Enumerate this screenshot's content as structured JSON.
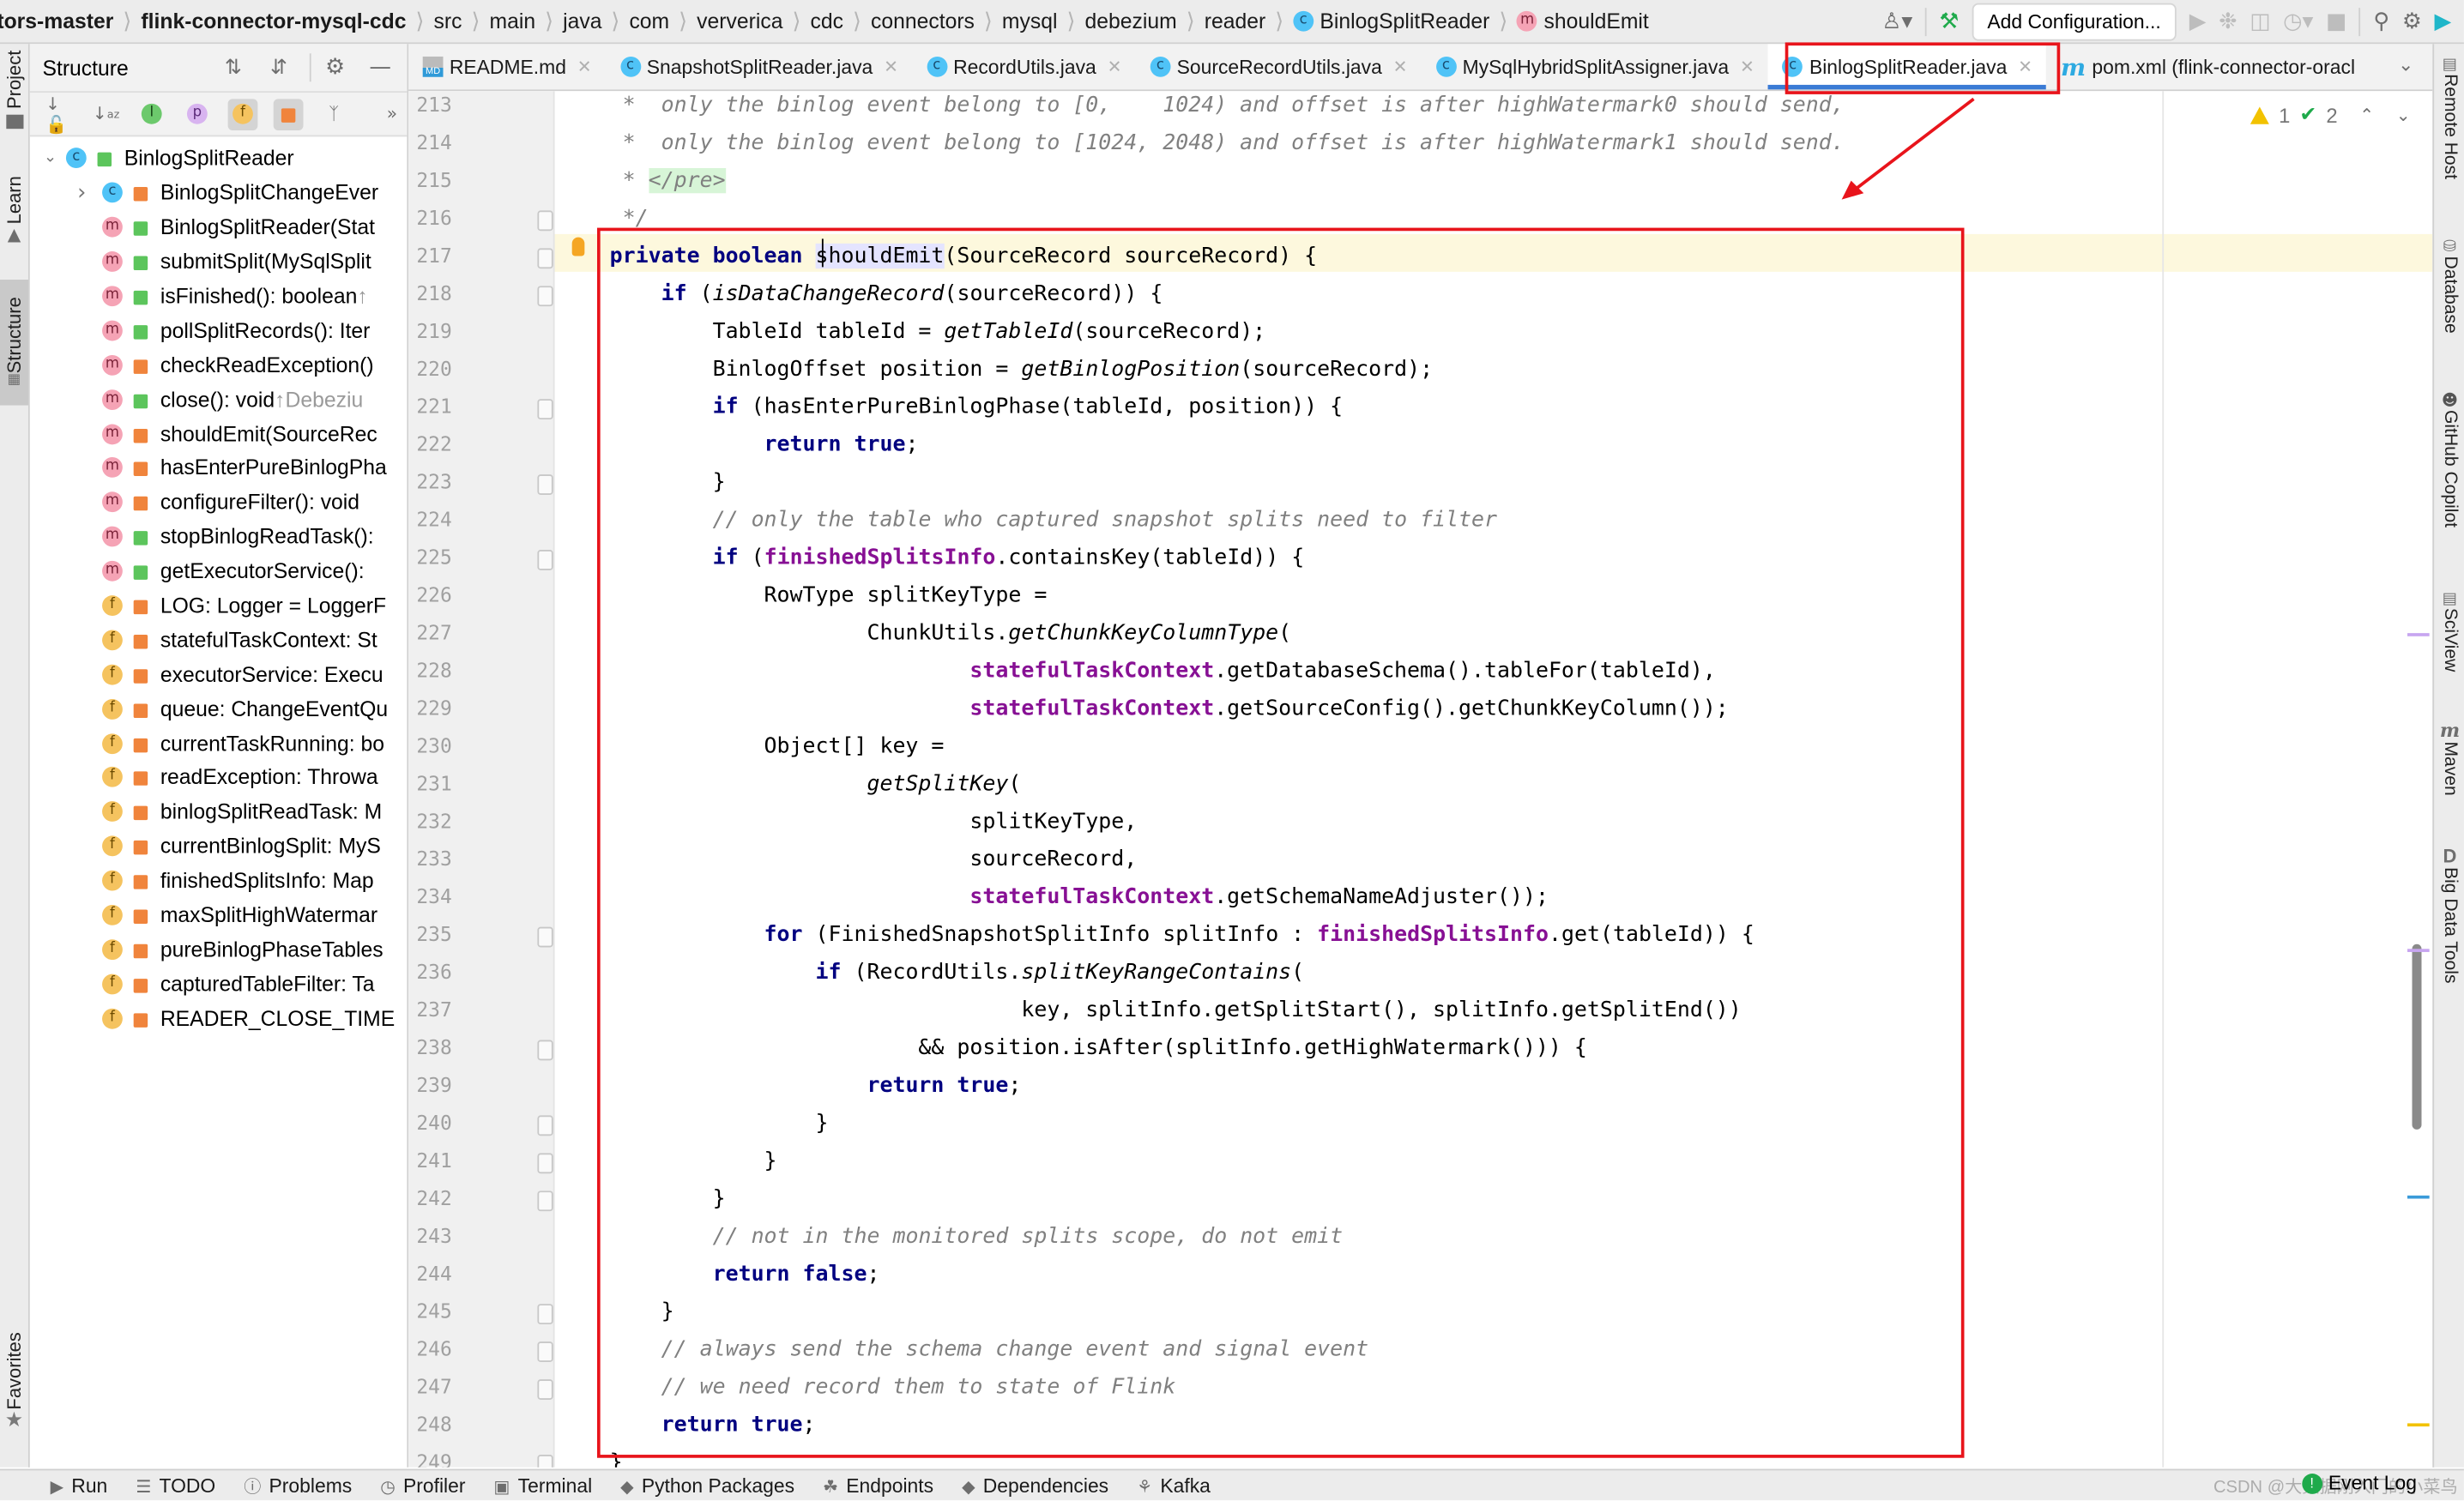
{
  "breadcrumb": {
    "items": [
      {
        "label": "tors-master",
        "bold": true
      },
      {
        "label": "flink-connector-mysql-cdc",
        "bold": true
      },
      {
        "label": "src"
      },
      {
        "label": "main"
      },
      {
        "label": "java"
      },
      {
        "label": "com"
      },
      {
        "label": "ververica"
      },
      {
        "label": "cdc"
      },
      {
        "label": "connectors"
      },
      {
        "label": "mysql"
      },
      {
        "label": "debezium"
      },
      {
        "label": "reader"
      },
      {
        "label": "BinlogSplitReader",
        "icon": "c"
      },
      {
        "label": "shouldEmit",
        "icon": "m"
      }
    ]
  },
  "toolbar": {
    "add_configuration": "Add Configuration..."
  },
  "left_strip": {
    "tabs": [
      "Project",
      "Learn",
      "Structure",
      "Favorites"
    ]
  },
  "right_strip": {
    "tabs": [
      "Remote Host",
      "Database",
      "GitHub Copilot",
      "SciView",
      "Maven",
      "Big Data Tools"
    ]
  },
  "structure": {
    "title": "Structure",
    "root": "BinlogSplitReader",
    "items": [
      {
        "kind": "c",
        "vis": "private",
        "label": "BinlogSplitChangeEver",
        "expandable": true
      },
      {
        "kind": "m",
        "vis": "public",
        "label": "BinlogSplitReader(Stat"
      },
      {
        "kind": "m",
        "vis": "public",
        "label": "submitSplit(MySqlSplit"
      },
      {
        "kind": "m",
        "vis": "public",
        "label": "isFinished(): boolean",
        "hint": " ↑"
      },
      {
        "kind": "m",
        "vis": "public",
        "label": "pollSplitRecords(): Iter"
      },
      {
        "kind": "m",
        "vis": "private",
        "label": "checkReadException()"
      },
      {
        "kind": "m",
        "vis": "public",
        "label": "close(): void",
        "hint": " ↑Debeziu"
      },
      {
        "kind": "m",
        "vis": "private",
        "label": "shouldEmit(SourceRec"
      },
      {
        "kind": "m",
        "vis": "private",
        "label": "hasEnterPureBinlogPha"
      },
      {
        "kind": "m",
        "vis": "private",
        "label": "configureFilter(): void"
      },
      {
        "kind": "m",
        "vis": "public",
        "label": "stopBinlogReadTask():"
      },
      {
        "kind": "m",
        "vis": "public",
        "label": "getExecutorService(): "
      },
      {
        "kind": "f",
        "vis": "private",
        "label": "LOG: Logger = LoggerF"
      },
      {
        "kind": "f",
        "vis": "private",
        "label": "statefulTaskContext: St"
      },
      {
        "kind": "f",
        "vis": "private",
        "label": "executorService: Execu"
      },
      {
        "kind": "f",
        "vis": "private",
        "label": "queue: ChangeEventQu"
      },
      {
        "kind": "f",
        "vis": "private",
        "label": "currentTaskRunning: bo"
      },
      {
        "kind": "f",
        "vis": "private",
        "label": "readException: Throwa"
      },
      {
        "kind": "f",
        "vis": "private",
        "label": "binlogSplitReadTask: M"
      },
      {
        "kind": "f",
        "vis": "private",
        "label": "currentBinlogSplit: MyS"
      },
      {
        "kind": "f",
        "vis": "private",
        "label": "finishedSplitsInfo: Map"
      },
      {
        "kind": "f",
        "vis": "private",
        "label": "maxSplitHighWatermar"
      },
      {
        "kind": "f",
        "vis": "private",
        "label": "pureBinlogPhaseTables"
      },
      {
        "kind": "f",
        "vis": "private",
        "label": "capturedTableFilter: Ta"
      },
      {
        "kind": "f",
        "vis": "private",
        "label": "READER_CLOSE_TIME"
      }
    ]
  },
  "tabs": [
    {
      "label": "README.md",
      "icon": "md"
    },
    {
      "label": "SnapshotSplitReader.java",
      "icon": "c"
    },
    {
      "label": "RecordUtils.java",
      "icon": "c"
    },
    {
      "label": "SourceRecordUtils.java",
      "icon": "c"
    },
    {
      "label": "MySqlHybridSplitAssigner.java",
      "icon": "c"
    },
    {
      "label": "BinlogSplitReader.java",
      "icon": "c",
      "active": true
    },
    {
      "label": "pom.xml (flink-connector-oracl",
      "icon": "maven"
    }
  ],
  "inspections": {
    "warnings": "1",
    "weak_warnings": "2"
  },
  "editor": {
    "first_line": 213,
    "current_line": 217,
    "lines": [
      [
        [
          "cm",
          " *  only the binlog event belong to [0,    1024) and offset is after highWatermark0 should send,"
        ]
      ],
      [
        [
          "cm",
          " *  only the binlog event belong to [1024, 2048) and offset is after highWatermark1 should send."
        ]
      ],
      [
        [
          "cm",
          " * "
        ],
        [
          "tag",
          "</pre>"
        ]
      ],
      [
        [
          "cm",
          " */"
        ]
      ],
      [
        [
          "kw",
          "private boolean "
        ],
        [
          "sel",
          "shouldEmit"
        ],
        [
          "",
          "(SourceRecord sourceRecord) {"
        ]
      ],
      [
        [
          "",
          "    "
        ],
        [
          "kw",
          "if"
        ],
        [
          "",
          " ("
        ],
        [
          "it",
          "isDataChangeRecord"
        ],
        [
          "",
          "(sourceRecord)) {"
        ]
      ],
      [
        [
          "",
          "        TableId tableId = "
        ],
        [
          "it",
          "getTableId"
        ],
        [
          "",
          "(sourceRecord);"
        ]
      ],
      [
        [
          "",
          "        BinlogOffset position = "
        ],
        [
          "it",
          "getBinlogPosition"
        ],
        [
          "",
          "(sourceRecord);"
        ]
      ],
      [
        [
          "",
          "        "
        ],
        [
          "kw",
          "if"
        ],
        [
          "",
          " (hasEnterPureBinlogPhase(tableId, position)) {"
        ]
      ],
      [
        [
          "",
          "            "
        ],
        [
          "kw",
          "return true"
        ],
        [
          "",
          ";"
        ]
      ],
      [
        [
          "",
          "        }"
        ]
      ],
      [
        [
          "",
          "        "
        ],
        [
          "cm",
          "// only the table who captured snapshot splits need to filter"
        ]
      ],
      [
        [
          "",
          "        "
        ],
        [
          "kw",
          "if"
        ],
        [
          "",
          " ("
        ],
        [
          "fld",
          "finishedSplitsInfo"
        ],
        [
          "",
          ".containsKey(tableId)) {"
        ]
      ],
      [
        [
          "",
          "            RowType splitKeyType ="
        ]
      ],
      [
        [
          "",
          "                    ChunkUtils."
        ],
        [
          "it",
          "getChunkKeyColumnType"
        ],
        [
          "",
          "("
        ]
      ],
      [
        [
          "",
          "                            "
        ],
        [
          "fld",
          "statefulTaskContext"
        ],
        [
          "",
          ".getDatabaseSchema().tableFor(tableId),"
        ]
      ],
      [
        [
          "",
          "                            "
        ],
        [
          "fld",
          "statefulTaskContext"
        ],
        [
          "",
          ".getSourceConfig().getChunkKeyColumn());"
        ]
      ],
      [
        [
          "",
          "            Object[] key ="
        ]
      ],
      [
        [
          "",
          "                    "
        ],
        [
          "it",
          "getSplitKey"
        ],
        [
          "",
          "("
        ]
      ],
      [
        [
          "",
          "                            splitKeyType,"
        ]
      ],
      [
        [
          "",
          "                            sourceRecord,"
        ]
      ],
      [
        [
          "",
          "                            "
        ],
        [
          "fld",
          "statefulTaskContext"
        ],
        [
          "",
          ".getSchemaNameAdjuster());"
        ]
      ],
      [
        [
          "",
          "            "
        ],
        [
          "kw",
          "for"
        ],
        [
          "",
          " (FinishedSnapshotSplitInfo splitInfo : "
        ],
        [
          "fld",
          "finishedSplitsInfo"
        ],
        [
          "",
          ".get(tableId)) {"
        ]
      ],
      [
        [
          "",
          "                "
        ],
        [
          "kw",
          "if"
        ],
        [
          "",
          " (RecordUtils."
        ],
        [
          "it",
          "splitKeyRangeContains"
        ],
        [
          "",
          "("
        ]
      ],
      [
        [
          "",
          "                                key, splitInfo.getSplitStart(), splitInfo.getSplitEnd())"
        ]
      ],
      [
        [
          "",
          "                        && position.isAfter(splitInfo.getHighWatermark())) {"
        ]
      ],
      [
        [
          "",
          "                    "
        ],
        [
          "kw",
          "return true"
        ],
        [
          "",
          ";"
        ]
      ],
      [
        [
          "",
          "                }"
        ]
      ],
      [
        [
          "",
          "            }"
        ]
      ],
      [
        [
          "",
          "        }"
        ]
      ],
      [
        [
          "",
          "        "
        ],
        [
          "cm",
          "// not in the monitored splits scope, do not emit"
        ]
      ],
      [
        [
          "",
          "        "
        ],
        [
          "kw",
          "return false"
        ],
        [
          "",
          ";"
        ]
      ],
      [
        [
          "",
          "    }"
        ]
      ],
      [
        [
          "",
          "    "
        ],
        [
          "cm",
          "// always send the schema change event and signal event"
        ]
      ],
      [
        [
          "",
          "    "
        ],
        [
          "cm",
          "// we need record them to state of Flink"
        ]
      ],
      [
        [
          "",
          "    "
        ],
        [
          "kw",
          "return true"
        ],
        [
          "",
          ";"
        ]
      ],
      [
        [
          "",
          "}"
        ]
      ]
    ],
    "fold_markers": [
      216,
      217,
      218,
      221,
      223,
      225,
      235,
      238,
      240,
      241,
      242,
      245,
      246,
      247,
      249
    ]
  },
  "bottom_bar": {
    "tools": [
      {
        "label": "Run",
        "icon": "▶"
      },
      {
        "label": "TODO",
        "icon": "☰"
      },
      {
        "label": "Problems",
        "icon": "ⓘ"
      },
      {
        "label": "Profiler",
        "icon": "◷"
      },
      {
        "label": "Terminal",
        "icon": "▣"
      },
      {
        "label": "Python Packages",
        "icon": "◆"
      },
      {
        "label": "Endpoints",
        "icon": "☘"
      },
      {
        "label": "Dependencies",
        "icon": "◆"
      },
      {
        "label": "Kafka",
        "icon": "⚘"
      }
    ],
    "event_log": "Event Log",
    "watermark": "CSDN @大数据刚入门的小菜鸟"
  },
  "colors": {
    "keyword": "#000080",
    "field": "#871094",
    "comment": "#808080",
    "annotation_red": "#e8141b",
    "active_tab_underline": "#3a7bd5"
  }
}
